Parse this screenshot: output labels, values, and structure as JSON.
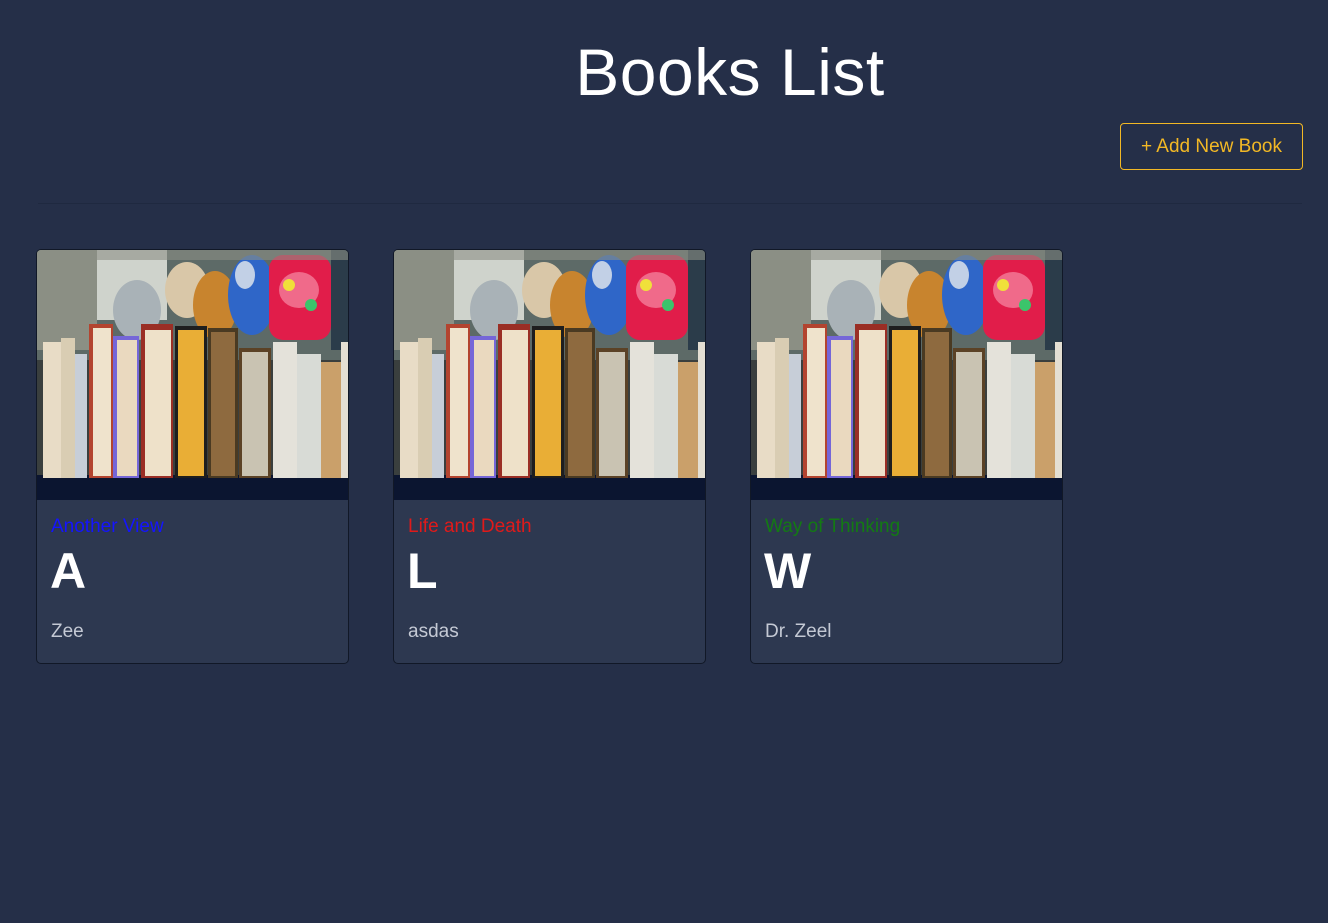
{
  "header": {
    "title": "Books List"
  },
  "toolbar": {
    "add_book_label": "+ Add New Book",
    "add_book_color": "#f2b825"
  },
  "colors": {
    "background": "#252f48",
    "card_background": "#2d3850"
  },
  "books": [
    {
      "category": "Another View",
      "category_color": "#1414ff",
      "letter": "A",
      "author": "Zee",
      "image": "books-shelf-photo"
    },
    {
      "category": "Life and Death",
      "category_color": "#e01a1a",
      "letter": "L",
      "author": "asdas",
      "image": "books-shelf-photo"
    },
    {
      "category": "Way of Thinking",
      "category_color": "#137a13",
      "letter": "W",
      "author": "Dr. Zeel",
      "image": "books-shelf-photo"
    }
  ]
}
